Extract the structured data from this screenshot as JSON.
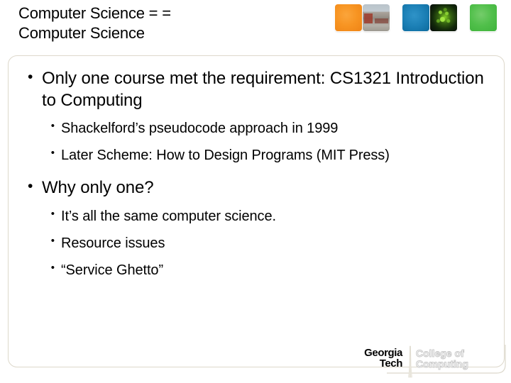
{
  "slide": {
    "title": "Computer Science = =\nComputer Science",
    "title_line_1": "Computer Science = =",
    "title_line_2": "Computer Science",
    "bullet_marker": "•",
    "bullets": [
      {
        "level": 1,
        "text": "Only one course met the requirement: CS1321 Introduction to Computing"
      },
      {
        "level": 2,
        "text": "Shackelford’s pseudocode approach in 1999"
      },
      {
        "level": 2,
        "text": "Later Scheme: How to Design Programs (MIT Press)"
      },
      {
        "level": 1,
        "text": "Why only one?"
      },
      {
        "level": 2,
        "text": "It’s all the same computer science."
      },
      {
        "level": 2,
        "text": "Resource issues"
      },
      {
        "level": 2,
        "text": "“Service Ghetto”"
      }
    ]
  },
  "header_images": [
    {
      "name": "orange-tile",
      "kind": "solid",
      "color": "#f79422"
    },
    {
      "name": "street-photo",
      "kind": "photo",
      "color": "#a9a39b"
    },
    {
      "name": "blue-tile",
      "kind": "solid",
      "color": "#1b7fb5"
    },
    {
      "name": "cell-photo",
      "kind": "photo",
      "color": "#5aaa19"
    },
    {
      "name": "green-tile",
      "kind": "solid",
      "color": "#50bf4a"
    }
  ],
  "logo": {
    "gt_line_1": "Georgia",
    "gt_line_2": "Tech",
    "coc_line_1": "College of",
    "coc_line_2": "Computing",
    "gt_color": "#000000",
    "coc_color": "#cccccc",
    "swoosh_color": "#d8d4c8"
  },
  "colors": {
    "background": "#ffffff",
    "text": "#000000",
    "content_box_border": "#ddd8cb"
  }
}
